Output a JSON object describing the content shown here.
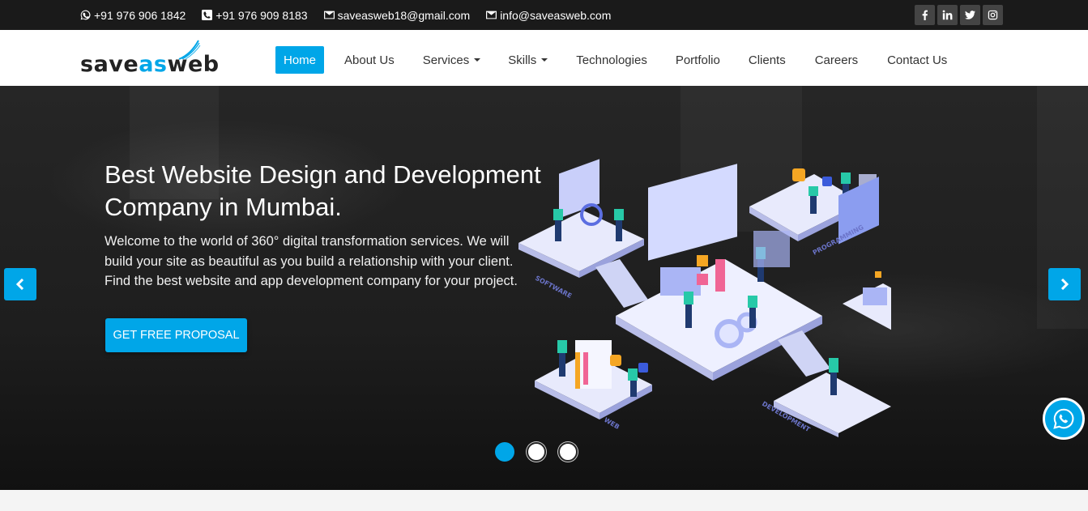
{
  "topbar": {
    "contacts": [
      {
        "icon": "whatsapp-icon",
        "text": "+91 976 906 1842"
      },
      {
        "icon": "phone-icon",
        "text": "+91 976 909 8183"
      },
      {
        "icon": "envelope-icon",
        "text": "saveasweb18@gmail.com"
      },
      {
        "icon": "envelope-icon",
        "text": "info@saveasweb.com"
      }
    ],
    "socials": [
      {
        "icon": "facebook-icon",
        "label": "f"
      },
      {
        "icon": "linkedin-icon",
        "label": "in"
      },
      {
        "icon": "twitter-icon",
        "label": ""
      },
      {
        "icon": "instagram-icon",
        "label": ""
      }
    ]
  },
  "logo": {
    "part1": "save",
    "part2": "as",
    "part3": "web"
  },
  "nav": {
    "items": [
      {
        "label": "Home",
        "active": true
      },
      {
        "label": "About Us"
      },
      {
        "label": "Services",
        "dropdown": true
      },
      {
        "label": "Skills",
        "dropdown": true
      },
      {
        "label": "Technologies"
      },
      {
        "label": "Portfolio"
      },
      {
        "label": "Clients"
      },
      {
        "label": "Careers"
      },
      {
        "label": "Contact Us"
      }
    ]
  },
  "hero": {
    "title": "Best Website Design and Development Company in Mumbai.",
    "text": "Welcome to the world of 360° digital transformation services. We will build your site as beautiful as you build a relationship with your client. Find the best website and app development company for your project.",
    "cta": "GET FREE PROPOSAL",
    "slides": 3,
    "active_slide": 1,
    "illustration_labels": [
      "SOFTWARE",
      "PROGRAMMING",
      "WEB",
      "DEVELOPMENT"
    ]
  },
  "colors": {
    "accent": "#00a6e8",
    "topbar": "#1a1a1a"
  }
}
